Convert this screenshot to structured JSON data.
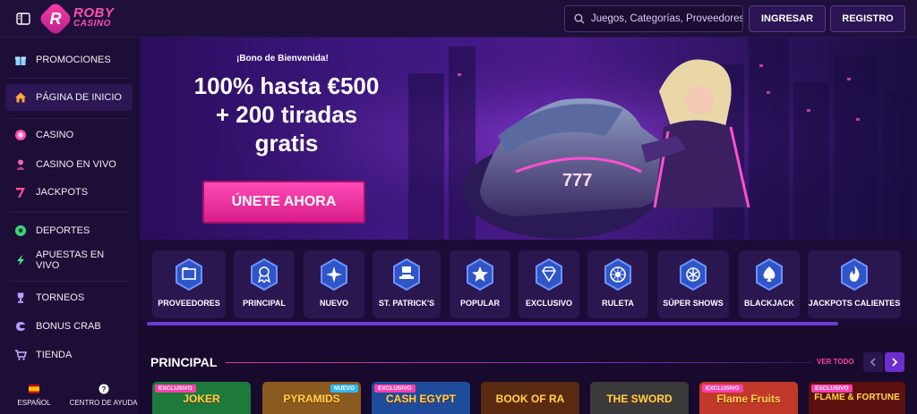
{
  "brand": {
    "name_line1": "ROBY",
    "name_line2": "CASINO",
    "badge": "R"
  },
  "search": {
    "placeholder": "Juegos, Categorías, Proveedores"
  },
  "auth": {
    "login": "INGRESAR",
    "register": "REGISTRO"
  },
  "sidebar": {
    "items": [
      {
        "label": "PROMOCIONES",
        "icon": "gift-icon"
      },
      {
        "label": "PÁGINA DE INICIO",
        "icon": "home-icon",
        "active": true
      },
      {
        "label": "CASINO",
        "icon": "casino-chip-icon"
      },
      {
        "label": "CASINO EN VIVO",
        "icon": "live-dealer-icon"
      },
      {
        "label": "JACKPOTS",
        "icon": "seven-icon"
      },
      {
        "label": "DEPORTES",
        "icon": "soccer-ball-icon"
      },
      {
        "label": "APUESTAS EN VIVO",
        "icon": "lightning-icon"
      },
      {
        "label": "TORNEOS",
        "icon": "trophy-icon"
      },
      {
        "label": "BONUS CRAB",
        "icon": "claw-icon"
      },
      {
        "label": "TIENDA",
        "icon": "cart-icon"
      }
    ],
    "footer": {
      "language": "ESPAÑOL",
      "help": "CENTRO DE AYUDA"
    }
  },
  "banner": {
    "kicker": "¡Bono de Bienvenida!",
    "title_line1": "100% hasta €500",
    "title_line2": "+ 200 tiradas",
    "title_line3": "gratis",
    "cta": "ÚNETE AHORA",
    "plate": "777"
  },
  "categories": [
    {
      "label": "PROVEEDORES",
      "icon": "folder-icon"
    },
    {
      "label": "PRINCIPAL",
      "icon": "award-icon"
    },
    {
      "label": "NUEVO",
      "icon": "sparkle-icon"
    },
    {
      "label": "ST. PATRICK'S",
      "icon": "leprechaun-hat-icon"
    },
    {
      "label": "POPULAR",
      "icon": "star-icon"
    },
    {
      "label": "EXCLUSIVO",
      "icon": "diamond-icon"
    },
    {
      "label": "RULETA",
      "icon": "roulette-icon"
    },
    {
      "label": "SÚPER SHOWS",
      "icon": "show-icon"
    },
    {
      "label": "BLACKJACK",
      "icon": "spade-icon"
    },
    {
      "label": "JACKPOTS CALIENTES",
      "icon": "flame-icon"
    }
  ],
  "section": {
    "title": "PRINCIPAL",
    "view_all": "VER TODO",
    "games": [
      {
        "title": "JOKER",
        "badge": "EXCLUSIVO",
        "bg": "#1d7a3a"
      },
      {
        "title": "PYRAMIDS",
        "badge": "NUEVO",
        "bg": "#8b5a1e"
      },
      {
        "title": "CASH EGYPT",
        "badge": "EXCLUSIVO",
        "bg": "#1e4c9a"
      },
      {
        "title": "BOOK OF RA",
        "badge": "",
        "bg": "#5a2a10"
      },
      {
        "title": "THE SWORD",
        "badge": "",
        "bg": "#3a3a3a"
      },
      {
        "title": "Flame Fruits",
        "badge": "EXCLUSIVO",
        "bg": "#c0392b"
      },
      {
        "title": "FLAME & FORTUNE",
        "badge": "EXCLUSIVO",
        "bg": "#5c1010"
      }
    ]
  },
  "colors": {
    "accent": "#ff3fae",
    "primary_purple": "#6b2fd0",
    "bg": "#170a2c"
  }
}
